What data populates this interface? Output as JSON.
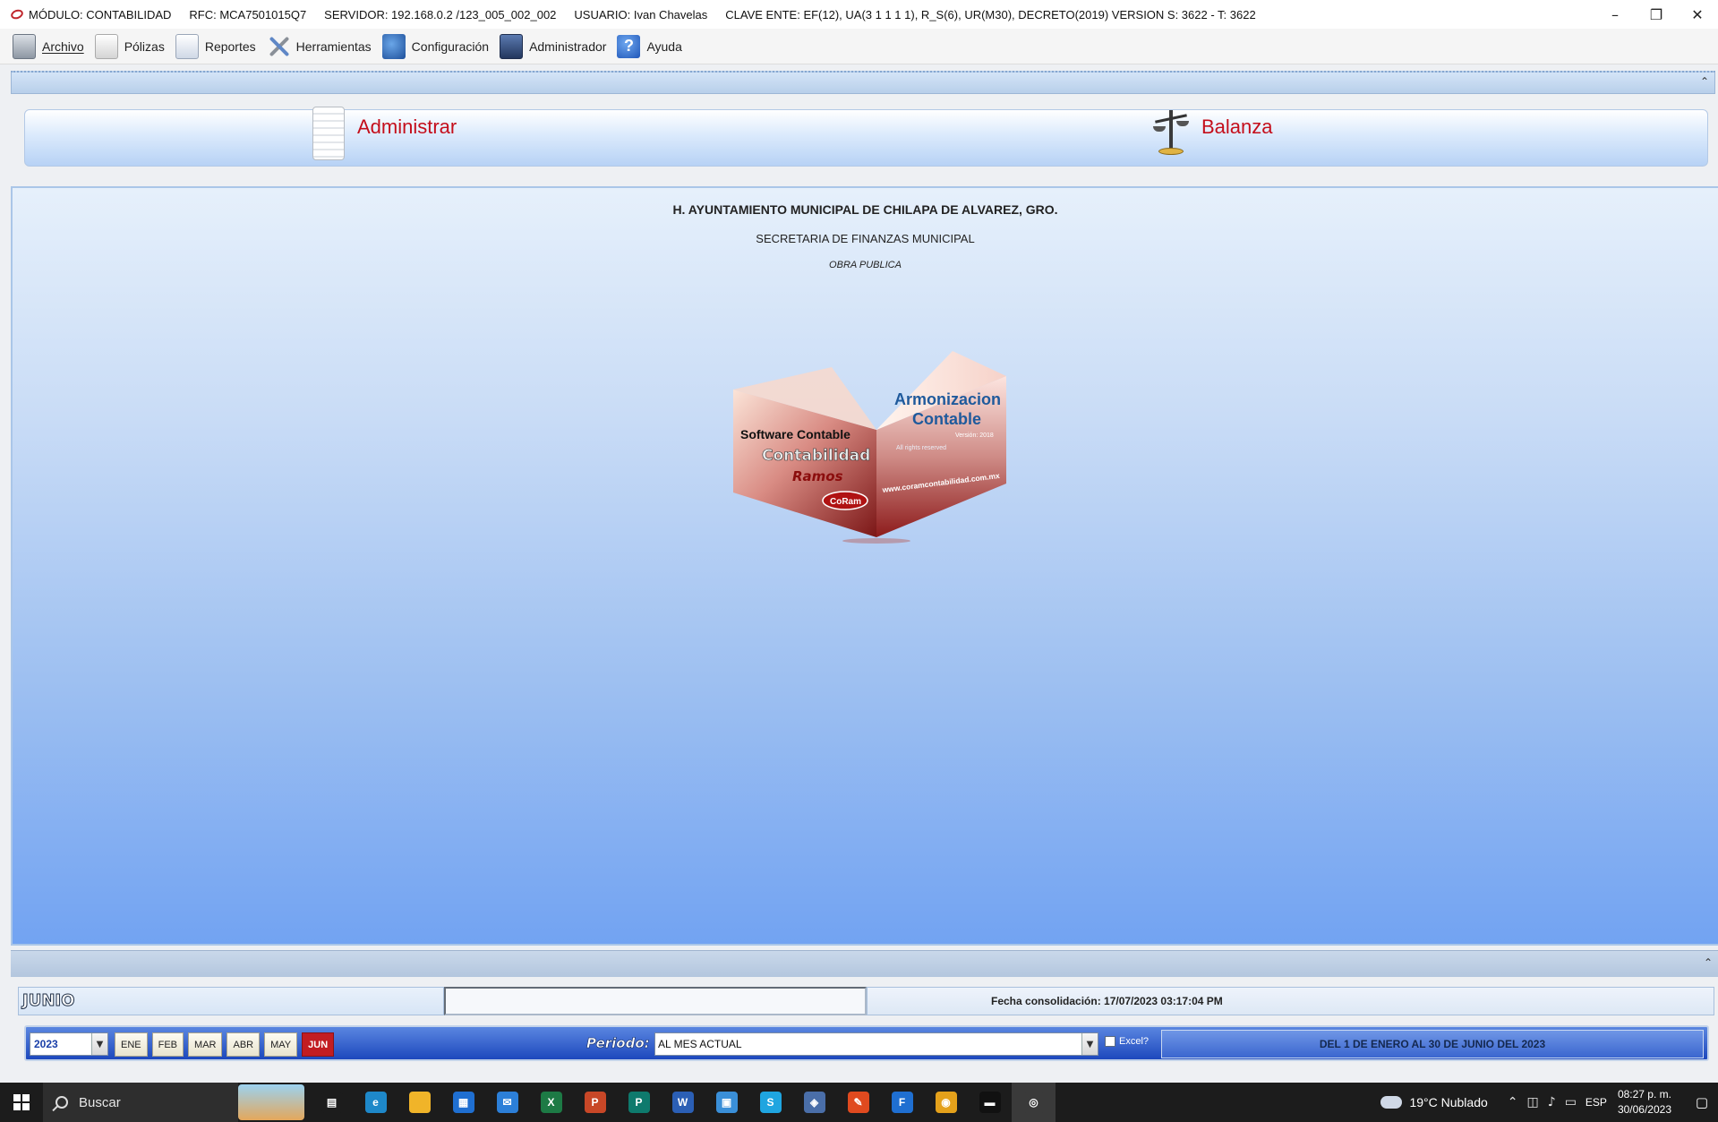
{
  "titlebar": {
    "items": [
      "MÓDULO: CONTABILIDAD",
      "RFC:  MCA7501015Q7",
      "SERVIDOR:  192.168.0.2 /123_005_002_002",
      "USUARIO:  Ivan Chavelas",
      "CLAVE ENTE:  EF(12),  UA(3 1 1 1 1),  R_S(6),  UR(M30),  DECRETO(2019)  VERSION S: 3622 - T: 3622"
    ],
    "minimize": "–",
    "restore": "❐",
    "close": "✕"
  },
  "menu": {
    "archivo": "Archivo",
    "polizas": "Pólizas",
    "reportes": "Reportes",
    "herramientas": "Herramientas",
    "configuracion": "Configuración",
    "administrador": "Administrador",
    "ayuda": "Ayuda",
    "ayuda_glyph": "?"
  },
  "collapse_glyph": "⌃",
  "shortcuts": {
    "administrar": "Administrar",
    "balanza": "Balanza"
  },
  "header": {
    "org_name": "H. AYUNTAMIENTO MUNICIPAL DE CHILAPA DE ALVAREZ, GRO.",
    "department": "SECRETARIA DE FINANZAS MUNICIPAL",
    "area": "OBRA PUBLICA"
  },
  "logo": {
    "line1": "Software Contable",
    "line2": "Contabilidad",
    "line3": "Ramos",
    "badge": "CoRam",
    "title1": "Armonizacion",
    "title2": "Contable",
    "version": "Versión: 2018",
    "rights": "All rights reserved",
    "url": "www.coramcontabilidad.com.mx"
  },
  "status": {
    "month": "JUNIO",
    "consolidation": "Fecha consolidación: 17/07/2023 03:17:04 PM"
  },
  "period": {
    "year": "2023",
    "months": [
      "ENE",
      "FEB",
      "MAR",
      "ABR",
      "MAY",
      "JUN"
    ],
    "active_month": "JUN",
    "periodo_label": "Periodo:",
    "periodo_value": "AL MES ACTUAL",
    "excel_label": "Excel?",
    "range": "DEL 1 DE ENERO AL 30 DE JUNIO DEL 2023",
    "dropdown_glyph": "▼"
  },
  "taskbar": {
    "search_label": "Buscar",
    "weather": "19°C  Nublado",
    "lang": "ESP",
    "time": "08:27 p. m.",
    "date": "30/06/2023",
    "apps": [
      {
        "name": "task-view-icon",
        "color": "#1c1c1c",
        "glyph": "▤"
      },
      {
        "name": "edge-icon",
        "color": "#1e88c9",
        "glyph": "e"
      },
      {
        "name": "file-explorer-icon",
        "color": "#f0b429",
        "glyph": ""
      },
      {
        "name": "store-icon",
        "color": "#1f6fd1",
        "glyph": "▦"
      },
      {
        "name": "mail-icon",
        "color": "#2c7fd8",
        "glyph": "✉"
      },
      {
        "name": "excel-icon",
        "color": "#1d7a45",
        "glyph": "X"
      },
      {
        "name": "powerpoint-icon",
        "color": "#c84727",
        "glyph": "P"
      },
      {
        "name": "publisher-icon",
        "color": "#0e7a6d",
        "glyph": "P"
      },
      {
        "name": "word-icon",
        "color": "#2b5fb5",
        "glyph": "W"
      },
      {
        "name": "photos-icon",
        "color": "#3a8fd8",
        "glyph": "▣"
      },
      {
        "name": "skype-icon",
        "color": "#1fa5e0",
        "glyph": "S"
      },
      {
        "name": "network-app-icon",
        "color": "#4a6ea8",
        "glyph": "◈"
      },
      {
        "name": "pdf-reader-icon",
        "color": "#e04a1f",
        "glyph": "✎"
      },
      {
        "name": "forms-icon",
        "color": "#1f6fd1",
        "glyph": "F"
      },
      {
        "name": "chrome-icon",
        "color": "#e4a11b",
        "glyph": "◉"
      },
      {
        "name": "terminal-icon",
        "color": "#111111",
        "glyph": "▬"
      },
      {
        "name": "contabilidad-app-icon",
        "color": "#3a3a3a",
        "glyph": "◎"
      }
    ]
  }
}
